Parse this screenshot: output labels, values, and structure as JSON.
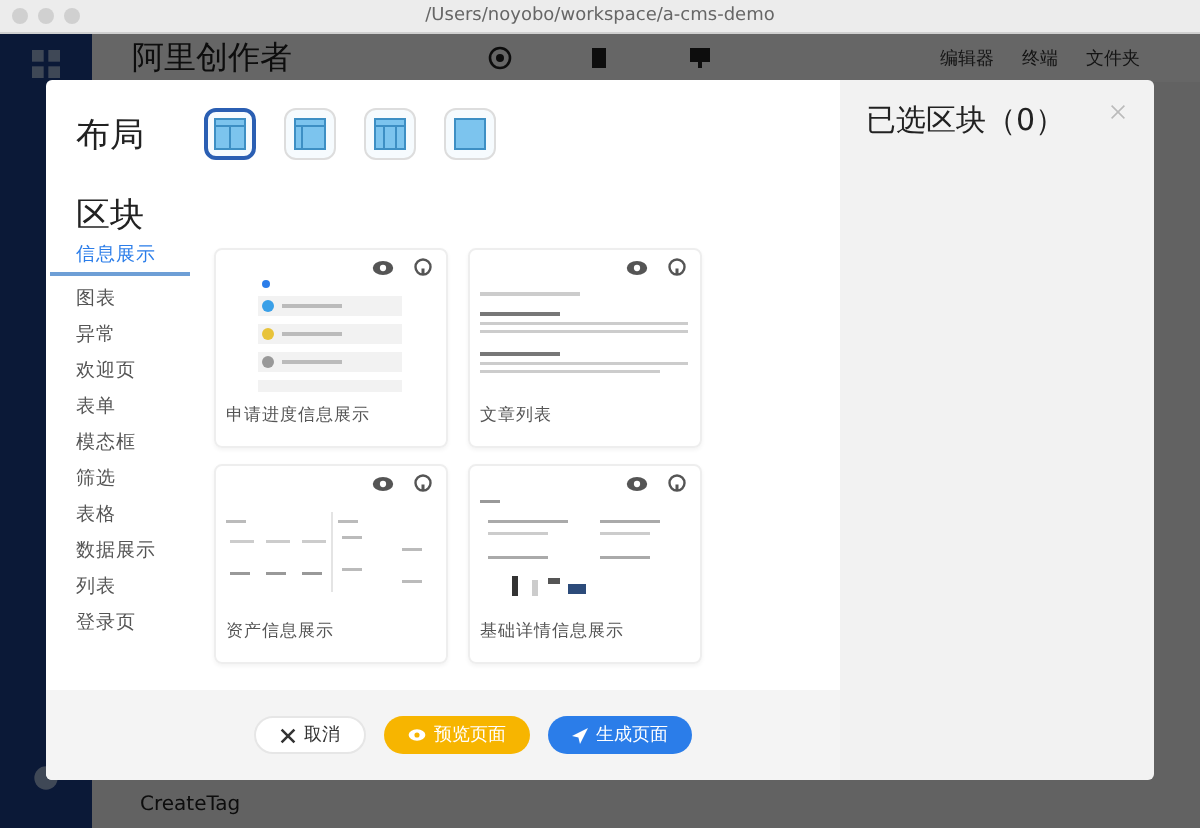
{
  "window": {
    "title": "/Users/noyobo/workspace/a-cms-demo"
  },
  "app": {
    "title": "阿里创作者",
    "breadcrumb": [
      "编辑器",
      "终端",
      "文件夹"
    ],
    "footer_item": "CreateTag"
  },
  "dialog": {
    "layout_heading": "布局",
    "layouts": [
      {
        "kind": "split",
        "selected": true
      },
      {
        "kind": "left",
        "selected": false
      },
      {
        "kind": "center",
        "selected": false
      },
      {
        "kind": "full",
        "selected": false
      }
    ],
    "blocks_heading": "区块",
    "categories": [
      {
        "label": "信息展示",
        "selected": true
      },
      {
        "label": "图表",
        "selected": false
      },
      {
        "label": "异常",
        "selected": false
      },
      {
        "label": "欢迎页",
        "selected": false
      },
      {
        "label": "表单",
        "selected": false
      },
      {
        "label": "模态框",
        "selected": false
      },
      {
        "label": "筛选",
        "selected": false
      },
      {
        "label": "表格",
        "selected": false
      },
      {
        "label": "数据展示",
        "selected": false
      },
      {
        "label": "列表",
        "selected": false
      },
      {
        "label": "登录页",
        "selected": false
      }
    ],
    "blocks": [
      {
        "title": "申请进度信息展示",
        "kind": "steps"
      },
      {
        "title": "文章列表",
        "kind": "articles"
      },
      {
        "title": "资产信息展示",
        "kind": "stats"
      },
      {
        "title": "基础详情信息展示",
        "kind": "details"
      }
    ],
    "selected_heading": "已选区块（0）",
    "buttons": [
      {
        "label": "取消",
        "kind": "cancel"
      },
      {
        "label": "预览页面",
        "kind": "preview"
      },
      {
        "label": "生成页面",
        "kind": "generate"
      }
    ]
  }
}
